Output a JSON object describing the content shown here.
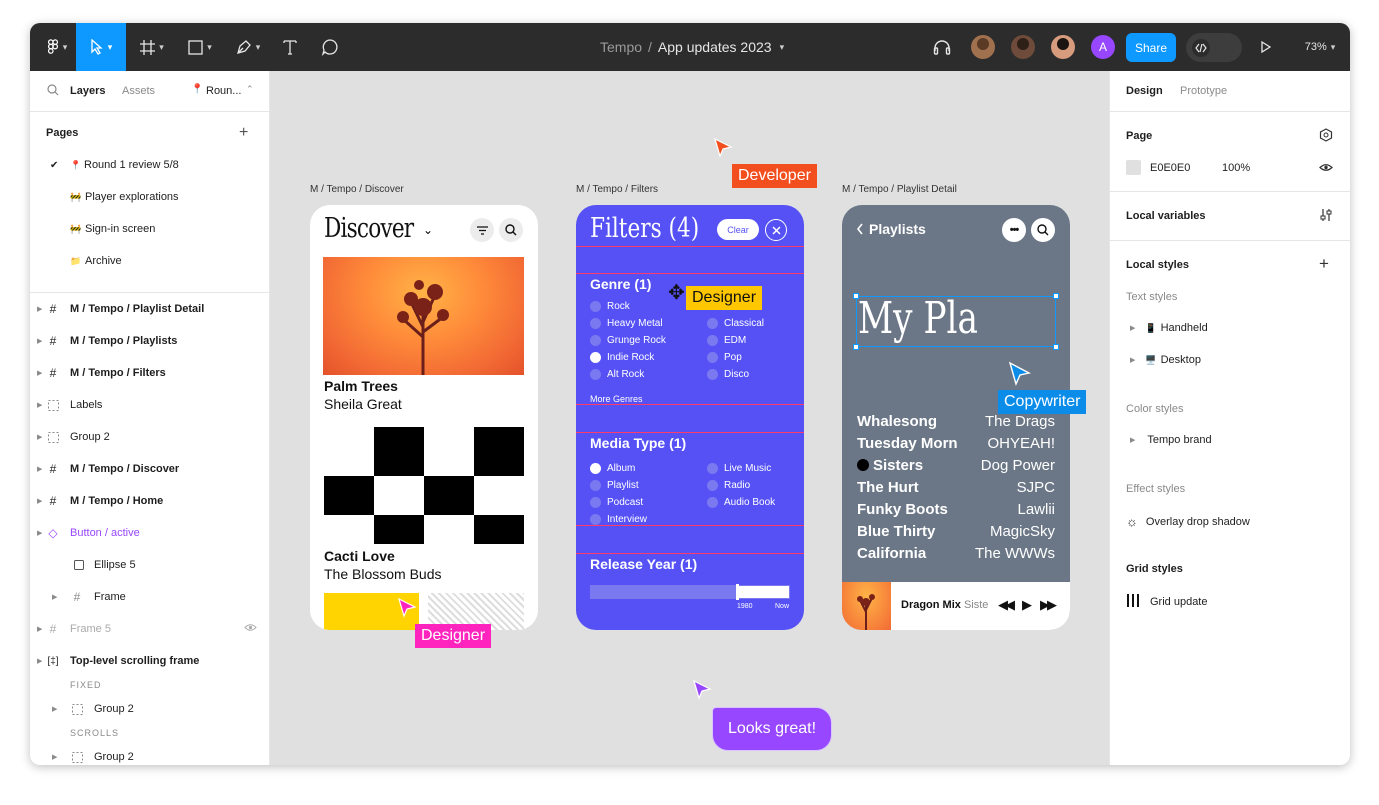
{
  "toolbar": {
    "project": "Tempo",
    "separator": "/",
    "file": "App updates 2023",
    "share_label": "Share",
    "zoom": "73%",
    "avatar_letter": "A"
  },
  "left_panel": {
    "tabs": {
      "layers": "Layers",
      "assets": "Assets",
      "page_picker": "Roun..."
    },
    "pages_title": "Pages",
    "pages": [
      {
        "label": "Round 1 review 5/8",
        "emoji": "📍",
        "current": true
      },
      {
        "label": "Player explorations",
        "emoji": "🚧"
      },
      {
        "label": "Sign-in screen",
        "emoji": "🚧"
      },
      {
        "label": "Archive",
        "emoji": "📁"
      }
    ],
    "layers": [
      {
        "label": "M / Tempo / Playlist Detail",
        "icon": "frame-icon",
        "bold": true
      },
      {
        "label": "M / Tempo / Playlists",
        "icon": "frame-icon",
        "bold": true
      },
      {
        "label": "M / Tempo / Filters",
        "icon": "frame-icon",
        "bold": true
      },
      {
        "label": "Labels",
        "icon": "group-icon"
      },
      {
        "label": "Group 2",
        "icon": "group-icon"
      },
      {
        "label": "M / Tempo / Discover",
        "icon": "frame-icon",
        "bold": true
      },
      {
        "label": "M / Tempo / Home",
        "icon": "frame-icon",
        "bold": true
      },
      {
        "label": "Button / active",
        "icon": "component-icon",
        "purple": true
      },
      {
        "label": "Ellipse 5",
        "icon": "rectangle-icon",
        "indent": true
      },
      {
        "label": "Frame",
        "icon": "frame-icon",
        "indent": true
      },
      {
        "label": "Frame 5",
        "icon": "frame-icon",
        "muted": true
      },
      {
        "label": "Top-level scrolling frame",
        "icon": "scroll-frame-icon",
        "bold": true
      },
      {
        "label": "FIXED",
        "section": true
      },
      {
        "label": "Group 2",
        "icon": "group-icon",
        "indent": true
      },
      {
        "label": "SCROLLS",
        "section": true
      },
      {
        "label": "Group 2",
        "icon": "group-icon",
        "indent": true
      }
    ]
  },
  "canvas": {
    "frames": [
      {
        "label": "M / Tempo / Discover"
      },
      {
        "label": "M / Tempo / Filters"
      },
      {
        "label": "M / Tempo / Playlist Detail"
      }
    ],
    "cursors": {
      "developer": "Developer",
      "designer_top": "Designer",
      "designer_bottom": "Designer",
      "copywriter": "Copywriter",
      "comment": "Looks great!"
    }
  },
  "discover": {
    "title": "Discover",
    "card1_title": "Palm Trees",
    "card1_artist": "Sheila Great",
    "card2_title": "Cacti Love",
    "card2_artist": "The Blossom Buds"
  },
  "filters": {
    "title": "Filters (4)",
    "clear": "Clear",
    "genre_title": "Genre (1)",
    "genres_left": [
      "Rock",
      "Heavy Metal",
      "Grunge Rock",
      "Indie Rock",
      "Alt Rock"
    ],
    "genres_right": [
      "",
      "Classical",
      "EDM",
      "Pop",
      "Disco"
    ],
    "more": "More Genres",
    "media_title": "Media Type (1)",
    "media_left": [
      "Album",
      "Playlist",
      "Podcast",
      "Interview"
    ],
    "media_right": [
      "Live Music",
      "Radio",
      "Audio Book",
      ""
    ],
    "year_title": "Release Year (1)",
    "year_from": "1980",
    "year_to": "Now"
  },
  "playlist": {
    "back": "Playlists",
    "title": "My Pla",
    "rows": [
      {
        "left": "Whalesong",
        "right": "The Drags"
      },
      {
        "left": "Tuesday Morn",
        "right": "OHYEAH!"
      },
      {
        "left": "Sisters",
        "right": "Dog Power"
      },
      {
        "left": "The Hurt",
        "right": "SJPC"
      },
      {
        "left": "Funky Boots",
        "right": "Lawlii"
      },
      {
        "left": "Blue Thirty",
        "right": "MagicSky"
      },
      {
        "left": "California",
        "right": "The WWWs"
      }
    ],
    "now_playing": "Dragon Mix",
    "now_playing_sub": "Siste"
  },
  "right_panel": {
    "tabs": {
      "design": "Design",
      "prototype": "Prototype"
    },
    "page_title": "Page",
    "page_color": "E0E0E0",
    "page_opacity": "100%",
    "local_variables": "Local variables",
    "local_styles": "Local styles",
    "text_styles": "Text styles",
    "text_items": [
      "Handheld",
      "Desktop"
    ],
    "color_styles": "Color styles",
    "color_items": [
      "Tempo brand"
    ],
    "effect_styles": "Effect styles",
    "effect_items": [
      "Overlay drop shadow"
    ],
    "grid_styles": "Grid styles",
    "grid_items": [
      "Grid update"
    ]
  },
  "colors": {
    "toolbar": "#2c2c2c",
    "accent": "#0d99ff",
    "filters_bg": "#5551f5",
    "playlist_bg": "#6b7786",
    "developer": "#f24e1e",
    "designer_yellow": "#ffc700",
    "designer_pink": "#ff24bd",
    "copywriter": "#0c8ce9",
    "comment": "#9747ff"
  }
}
